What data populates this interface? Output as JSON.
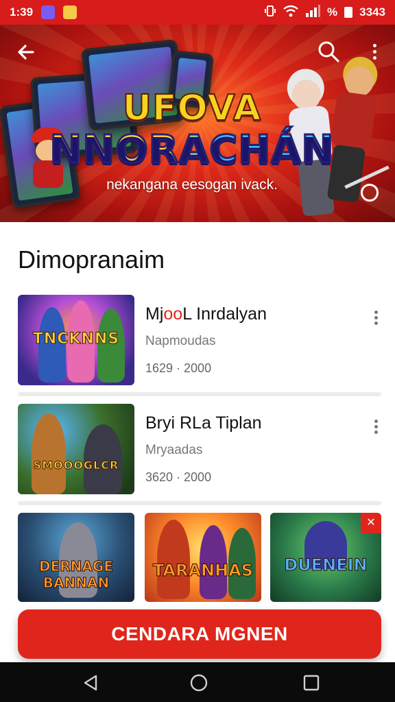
{
  "status_bar": {
    "time": "1:39",
    "right_text": "3343",
    "signal_pct": "%"
  },
  "banner": {
    "title_line1": "UFOVA",
    "title_line2": "NNORACHÁN",
    "subtitle": "nekangana eesogan ivack."
  },
  "section": {
    "title": "Dimopranaim"
  },
  "games": [
    {
      "title_prefix": "Mj",
      "title_highlight": "oo",
      "title_suffix": "L Inrdalyan",
      "subtitle": "Napmoudas",
      "meta": "1629 · 2000",
      "thumb_label": "TNCKNNS"
    },
    {
      "title_prefix": "Bryi RLa Tiplan",
      "title_highlight": "",
      "title_suffix": "",
      "subtitle": "Mryaadas",
      "meta": "3620 · 2000",
      "thumb_label": "SMOOOGLCR"
    }
  ],
  "tiles": [
    {
      "label": "DERNAGE BANNAN"
    },
    {
      "label": "TARANHAS"
    },
    {
      "label": "DUENEIN"
    }
  ],
  "cta": {
    "label": "CENDARA MGNEN"
  },
  "colors": {
    "accent": "#e0261c",
    "status_bar": "#d81b1b",
    "nav_bar": "#0b0b0b"
  },
  "icons": {
    "back": "arrow-left-icon",
    "search": "search-icon",
    "more": "more-vertical-icon",
    "refresh": "refresh-icon"
  }
}
